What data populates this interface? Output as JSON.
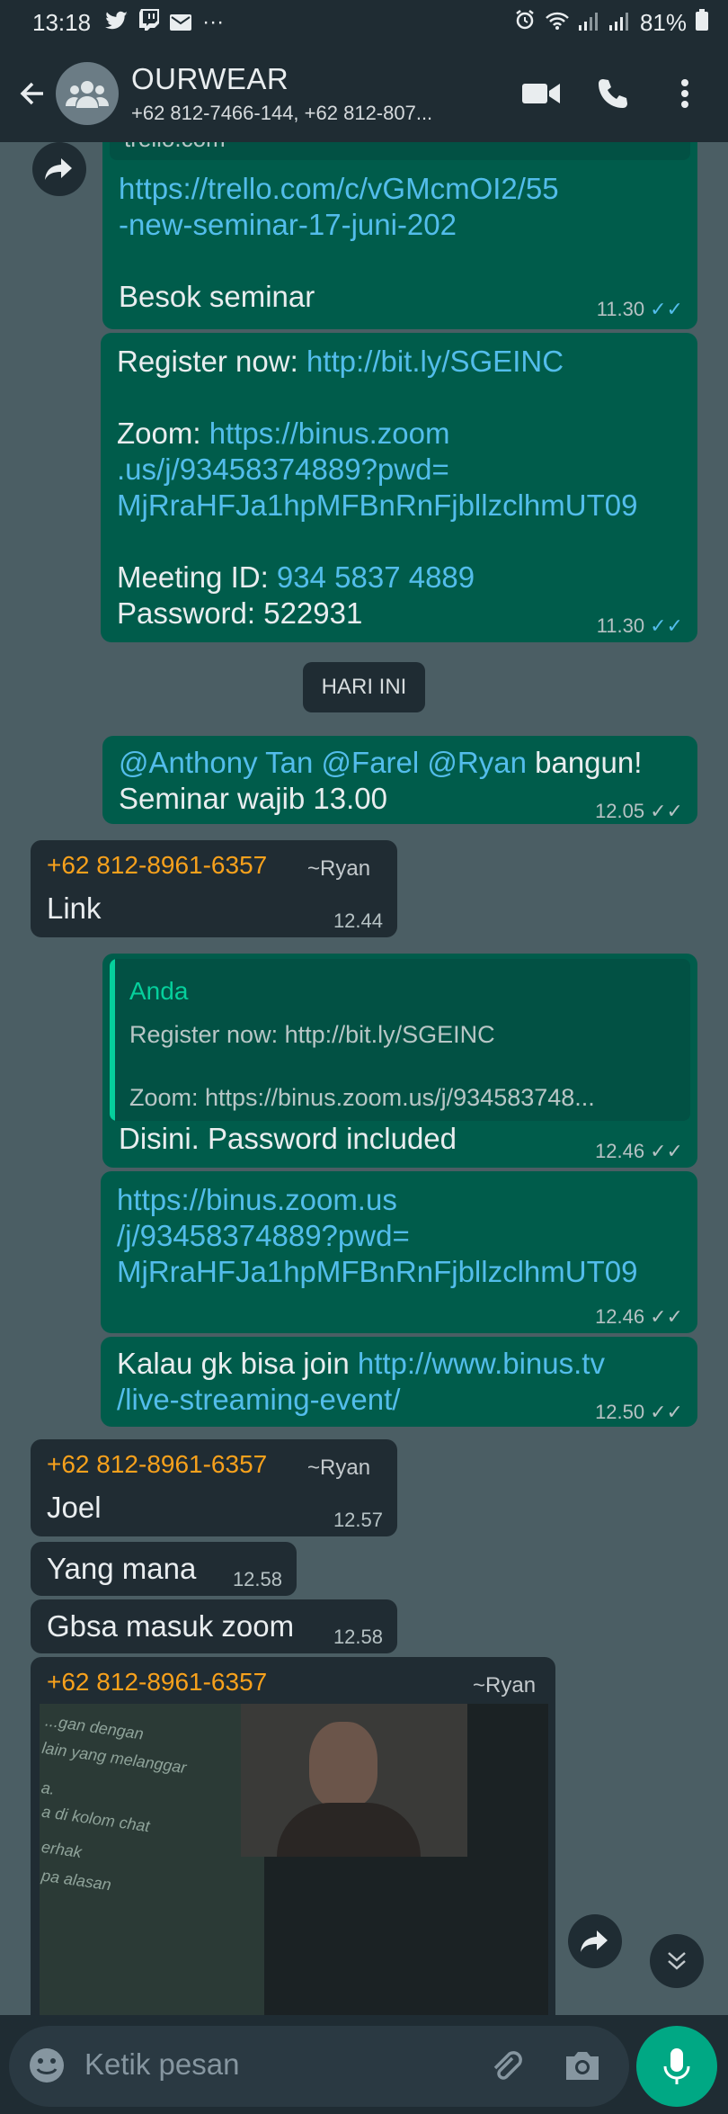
{
  "status_bar": {
    "time": "13:18",
    "notification_icons": [
      "twitter-icon",
      "twitch-icon",
      "mail-icon"
    ],
    "more": "···",
    "battery": "81%"
  },
  "header": {
    "title": "OURWEAR",
    "members": "+62 812-7466-144, +62 812-807..."
  },
  "messages": {
    "m1": {
      "preview": "trello.com",
      "link_line1": "https://trello.com/c/vGMcmOI2/55",
      "link_line2": "-new-seminar-17-juni-202",
      "text": "Besok seminar",
      "time": "11.30",
      "ticks": "✓✓"
    },
    "m2": {
      "register_label": "Register now: ",
      "register_link": "http://bit.ly/SGEINC",
      "zoom_label": "Zoom: ",
      "zoom_link1": "https://binus.zoom",
      "zoom_link2": ".us/j/93458374889?pwd=",
      "zoom_link3": "MjRraHFJa1hpMFBnRnFjbllzclhmUT09",
      "meeting_label": "Meeting ID: ",
      "meeting_id": "934 5837 4889",
      "password_line": "Password: 522931",
      "time": "11.30",
      "ticks": "✓✓"
    },
    "date_chip": "HARI INI",
    "m3": {
      "mention1": "@Anthony Tan",
      "mention2": "@Farel",
      "mention3": "@Ryan",
      "tail": " bangun!",
      "line2": "Seminar wajib 13.00",
      "time": "12.05",
      "ticks": "✓✓"
    },
    "m4": {
      "sender": "+62 812-8961-6357",
      "alias": "~Ryan",
      "text": "Link",
      "time": "12.44"
    },
    "m5": {
      "quote_name": "Anda",
      "quote_line1": "Register now: http://bit.ly/SGEINC",
      "quote_line2": "Zoom: https://binus.zoom.us/j/934583748...",
      "text": "Disini. Password included",
      "time": "12.46",
      "ticks": "✓✓"
    },
    "m6": {
      "link1": "https://binus.zoom.us",
      "link2": "/j/93458374889?pwd=",
      "link3": "MjRraHFJa1hpMFBnRnFjbllzclhmUT09",
      "time": "12.46",
      "ticks": "✓✓"
    },
    "m7": {
      "text": "Kalau gk bisa join ",
      "link1": "http://www.binus.tv",
      "link2": "/live-streaming-event/",
      "time": "12.50",
      "ticks": "✓✓"
    },
    "m8": {
      "sender": "+62 812-8961-6357",
      "alias": "~Ryan",
      "text": "Joel",
      "time": "12.57"
    },
    "m9": {
      "text": "Yang mana",
      "time": "12.58"
    },
    "m10": {
      "text": "Gbsa masuk zoom",
      "time": "12.58"
    },
    "m11": {
      "sender": "+62 812-8961-6357",
      "alias": "~Ryan",
      "photo_text": [
        "...gan dengan",
        "lain yang melanggar",
        "a.",
        "a di kolom chat",
        "erhak",
        "pa alasan"
      ]
    }
  },
  "input": {
    "placeholder": "Ketik pesan"
  },
  "colors": {
    "header_bg": "#1f2c33",
    "chat_bg": "#4b5e64",
    "outgoing_bubble": "#005c4b",
    "incoming_bubble": "#202c33",
    "link": "#53bdeb",
    "sender_name": "#f7a11c",
    "read_ticks": "#53bdeb",
    "accent": "#00a884"
  }
}
